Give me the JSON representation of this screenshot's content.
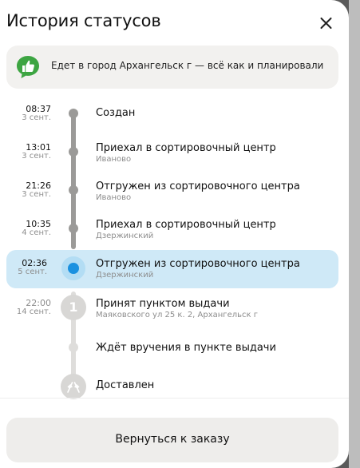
{
  "header": {
    "title": "История статусов"
  },
  "banner": {
    "text": "Едет в город Архангельск г — всё как и планировали",
    "icon": "thumbs-up-icon"
  },
  "colors": {
    "accent": "#1a91e0",
    "current_row_bg": "#cfe9f7",
    "done_line": "#9b9a98",
    "todo_line": "#dedddb"
  },
  "timeline": [
    {
      "time": "08:37",
      "date": "3 сент.",
      "status": "Создан",
      "place": ""
    },
    {
      "time": "13:01",
      "date": "3 сент.",
      "status": "Приехал в сортировочный центр",
      "place": "Иваново"
    },
    {
      "time": "21:26",
      "date": "3 сент.",
      "status": "Отгружен из сортировочного центра",
      "place": "Иваново"
    },
    {
      "time": "10:35",
      "date": "4 сент.",
      "status": "Приехал в сортировочный центр",
      "place": "Дзержинский"
    },
    {
      "time": "02:36",
      "date": "5 сент.",
      "status": "Отгружен из сортировочного центра",
      "place": "Дзержинский",
      "current": true
    },
    {
      "time": "22:00",
      "date": "14 сент.",
      "status": "Принят пунктом выдачи",
      "place": "Маяковского ул 25 к. 2, Архангельск г",
      "marker_number": "1"
    },
    {
      "time": "",
      "date": "",
      "status": "Ждёт вручения в пункте выдачи",
      "place": ""
    },
    {
      "time": "",
      "date": "",
      "status": "Доставлен",
      "place": "",
      "icon": "finish-flags-icon"
    }
  ],
  "footer": {
    "back_label": "Вернуться к заказу"
  }
}
